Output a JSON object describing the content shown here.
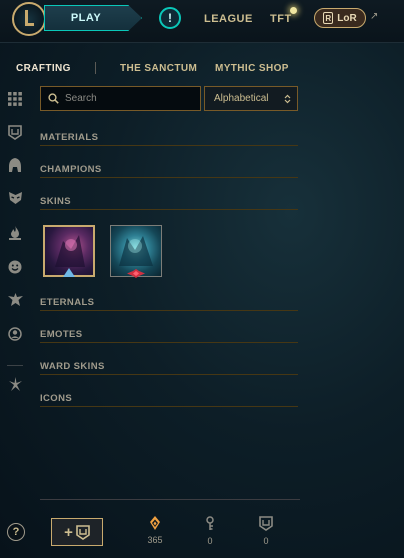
{
  "topbar": {
    "play_label": "PLAY",
    "alert_label": "!",
    "league_label": "LEAGUE",
    "tft_label": "TFT",
    "lor_label": "LoR",
    "lor_badge": "R",
    "external_icon": "↗"
  },
  "subnav": {
    "crafting": "CRAFTING",
    "sanctum": "THE SANCTUM",
    "mythic_shop": "MYTHIC SHOP"
  },
  "filters": {
    "search_placeholder": "Search",
    "sort_value": "Alphabetical"
  },
  "sections": {
    "materials": "MATERIALS",
    "champions": "CHAMPIONS",
    "skins": "SKINS",
    "eternals": "ETERNALS",
    "emotes": "EMOTES",
    "ward_skins": "WARD SKINS",
    "icons": "ICONS"
  },
  "sidebar_icons": [
    "grid-icon",
    "ward-icon",
    "helmet-icon",
    "mask-icon",
    "flame-icon",
    "emote-face-icon",
    "crest-icon",
    "summoner-icon",
    "eternals-icon"
  ],
  "footer": {
    "help_label": "?",
    "add_plus": "+",
    "blue_essence": "365",
    "keys": "0",
    "chests": "0"
  },
  "colors": {
    "gold": "#c8aa6e",
    "teal": "#0ac8b9",
    "text": "#a09b8c",
    "orange_essence": "#f0a040"
  }
}
